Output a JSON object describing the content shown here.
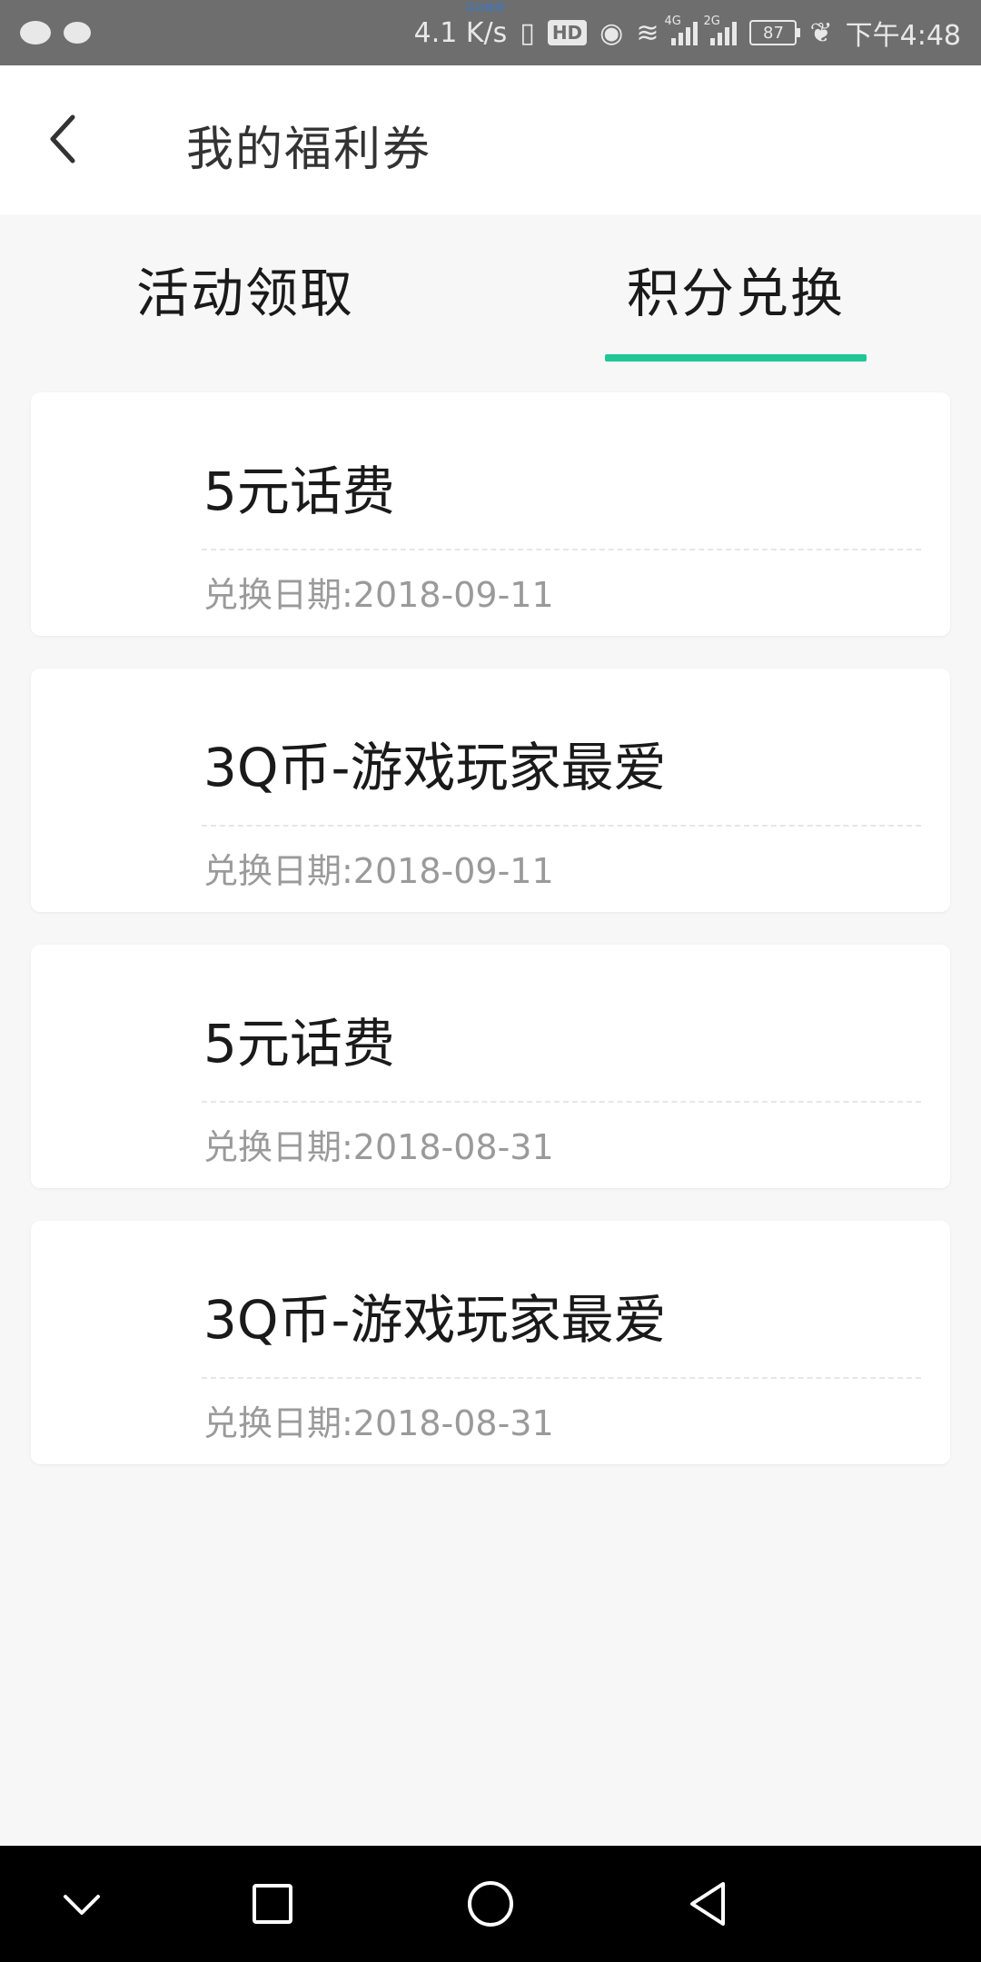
{
  "status_bar": {
    "top_tiny_text": "活动推荐",
    "speed": "4.1 K/s",
    "hd": "HD",
    "signal_1_tag": "4G",
    "signal_2_tag": "2G",
    "battery": "87",
    "time": "下午4:48"
  },
  "header": {
    "title": "我的福利券"
  },
  "tabs": [
    {
      "label": "活动领取"
    },
    {
      "label": "积分兑换"
    }
  ],
  "active_tab_index": 1,
  "accent_color": "#1fc796",
  "coupons": [
    {
      "title": "5元话费",
      "date": "兑换日期:2018-09-11"
    },
    {
      "title": "3Q币-游戏玩家最爱",
      "date": "兑换日期:2018-09-11"
    },
    {
      "title": "5元话费",
      "date": "兑换日期:2018-08-31"
    },
    {
      "title": "3Q币-游戏玩家最爱",
      "date": "兑换日期:2018-08-31"
    }
  ],
  "nav_icons": [
    "chevron-down-icon",
    "square-icon",
    "circle-icon",
    "triangle-back-icon"
  ]
}
